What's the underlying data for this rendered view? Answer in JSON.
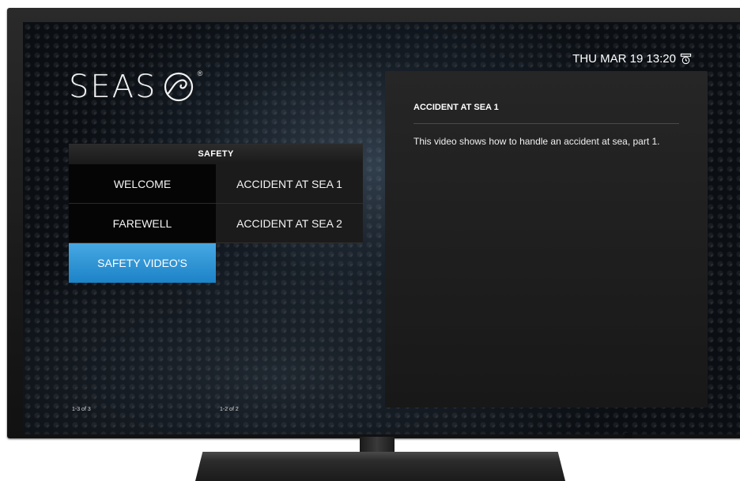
{
  "brand": {
    "name": "SEAS",
    "registered_mark": "®"
  },
  "clock": {
    "text": "THU MAR 19 13:20",
    "icon": "alarm-clock-icon"
  },
  "menu": {
    "header": "SAFETY",
    "left_items": [
      {
        "label": "WELCOME",
        "selected": false
      },
      {
        "label": "FAREWELL",
        "selected": false
      },
      {
        "label": "SAFETY VIDEO'S",
        "selected": true
      }
    ],
    "right_items": [
      {
        "label": "ACCIDENT AT SEA 1",
        "selected": false
      },
      {
        "label": "ACCIDENT AT SEA 2",
        "selected": false
      }
    ],
    "left_pager": "1-3 of 3",
    "right_pager": "1-2 of 2"
  },
  "detail": {
    "title": "ACCIDENT AT SEA 1",
    "description": "This video shows how to handle an accident at sea, part 1."
  },
  "colors": {
    "accent": "#2a92d4",
    "panel": "#1e1e1e",
    "screen_bg": "#0b0f14"
  }
}
